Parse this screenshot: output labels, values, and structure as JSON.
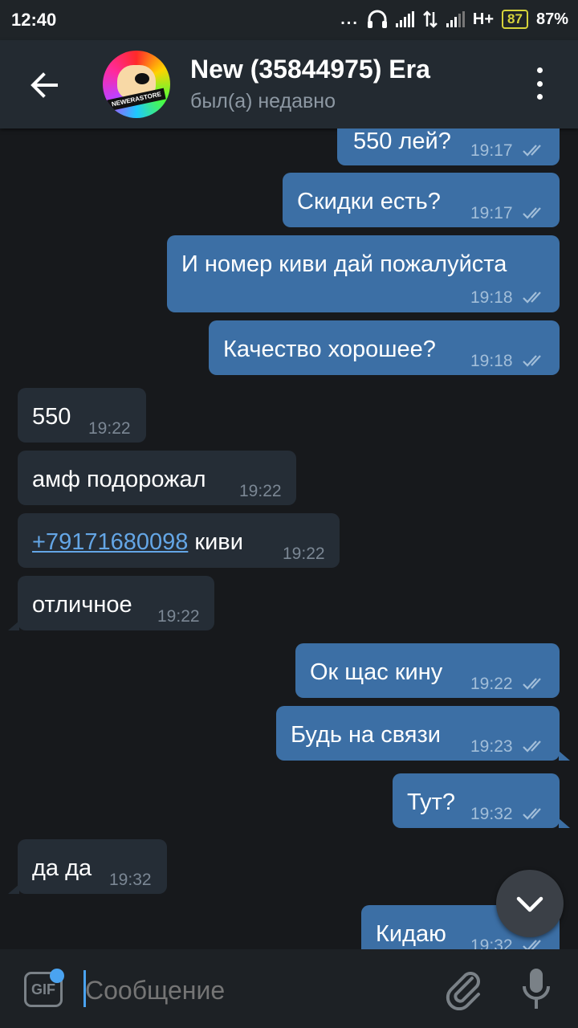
{
  "status_bar": {
    "time": "12:40",
    "dots": "...",
    "network": "H+",
    "battery_level": "87",
    "battery_percent": "87%",
    "icons": [
      "headphones-icon",
      "signal-icon",
      "data-arrows-icon",
      "signal-icon",
      "battery-icon"
    ]
  },
  "header": {
    "title": "New (35844975) Era",
    "subtitle": "был(а) недавно",
    "avatar_text": "NEWERASTORE",
    "icons": [
      "back-arrow-icon",
      "more-vertical-icon"
    ]
  },
  "messages": [
    {
      "dir": "out",
      "text": "550 лей?",
      "time": "19:17",
      "read": true
    },
    {
      "dir": "out",
      "text": "Скидки есть?",
      "time": "19:17",
      "read": true
    },
    {
      "dir": "out",
      "text": "И номер киви дай пожалуйста",
      "time": "19:18",
      "read": true
    },
    {
      "dir": "out",
      "text": "Качество хорошее?",
      "time": "19:18",
      "read": true
    },
    {
      "dir": "in",
      "text": "550",
      "time": "19:22"
    },
    {
      "dir": "in",
      "text": "амф подорожал",
      "time": "19:22"
    },
    {
      "dir": "in",
      "link": "+79171680098",
      "text": " киви",
      "time": "19:22"
    },
    {
      "dir": "in",
      "text": "отличное",
      "time": "19:22"
    },
    {
      "dir": "out",
      "text": "Ок щас кину",
      "time": "19:22",
      "read": true
    },
    {
      "dir": "out",
      "text": "Будь на связи",
      "time": "19:23",
      "read": true
    },
    {
      "dir": "out",
      "text": "Тут?",
      "time": "19:32",
      "read": true
    },
    {
      "dir": "in",
      "text": "да да",
      "time": "19:32"
    },
    {
      "dir": "out",
      "text": "Кидаю",
      "time": "19:32",
      "read": true
    }
  ],
  "composer": {
    "gif_label": "GIF",
    "placeholder": "Сообщение",
    "icons": [
      "gif-icon",
      "attach-paperclip-icon",
      "microphone-icon",
      "scroll-down-chevron-icon"
    ]
  },
  "colors": {
    "outgoing_bubble": "#3c6fa5",
    "incoming_bubble": "#252d36",
    "background": "#17191c",
    "link": "#64a6e6",
    "accent": "#4aa3f0"
  }
}
